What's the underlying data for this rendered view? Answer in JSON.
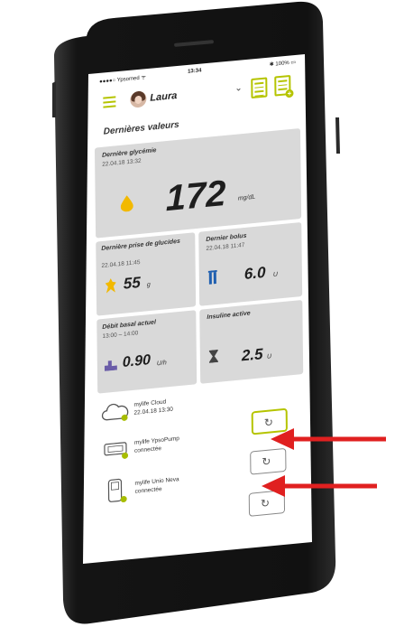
{
  "status": {
    "carrier": "●●●●○ Ypsomed ᯤ",
    "time": "13:34",
    "battery": "✱ 100% ▭"
  },
  "header": {
    "user_name": "Laura"
  },
  "section_title": "Dernières valeurs",
  "glycemia": {
    "label": "Dernière glycémie",
    "timestamp": "22.04.18  13:32",
    "value": "172",
    "unit": "mg/dL"
  },
  "carbs": {
    "label": "Dernière prise de glucides",
    "timestamp": "22.04.18  11:45",
    "value": "55",
    "unit": "g"
  },
  "bolus": {
    "label": "Dernier bolus",
    "timestamp": "22.04.18  11:47",
    "value": "6.0",
    "unit": "U"
  },
  "basal": {
    "label": "Débit basal actuel",
    "timestamp": "13:00 – 14:00",
    "value": "0.90",
    "unit": "U/h"
  },
  "insulin": {
    "label": "Insuline active",
    "value": "2.5",
    "unit": "U"
  },
  "devices": [
    {
      "name": "mylife Cloud",
      "status": "22.04.18  13:30"
    },
    {
      "name": "mylife YpsoPump",
      "status": "connectée"
    },
    {
      "name": "mylife Unio Neva",
      "status": "connectée"
    }
  ],
  "colors": {
    "accent": "#b5c400",
    "card": "#d9d9d9",
    "arrow": "#e02020",
    "phone": "#1a1a1a"
  },
  "icons": {
    "menu": "hamburger-menu-icon",
    "sync": "refresh-icon",
    "drop": "blood-drop-icon",
    "bolus": "insulin-pen-icon",
    "timer": "hourglass-icon"
  }
}
